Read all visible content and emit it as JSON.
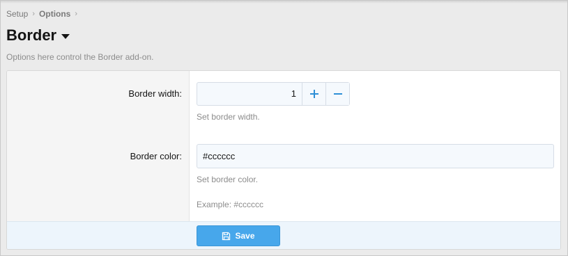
{
  "breadcrumb": {
    "items": [
      "Setup",
      "Options"
    ],
    "separator": "›"
  },
  "page": {
    "title": "Border",
    "description": "Options here control the Border add-on."
  },
  "form": {
    "border_width": {
      "label": "Border width:",
      "value": "1",
      "hint": "Set border width."
    },
    "border_color": {
      "label": "Border color:",
      "value": "#cccccc",
      "hint": "Set border color.",
      "example": "Example: #cccccc"
    }
  },
  "footer": {
    "save_label": "Save"
  },
  "icons": {
    "increment": "plus-icon",
    "decrement": "minus-icon",
    "save": "floppy-disk-icon",
    "title_menu": "caret-down-icon"
  },
  "colors": {
    "accent": "#47a7eb",
    "stepper_button": "#2e8fd6"
  }
}
